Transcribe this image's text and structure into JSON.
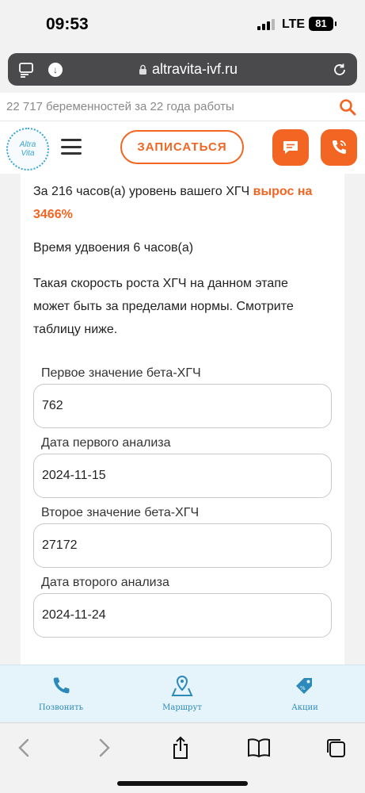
{
  "status_bar": {
    "time": "09:53",
    "network": "LTE",
    "battery": "81"
  },
  "browser": {
    "domain": "altravita-ivf.ru"
  },
  "site": {
    "tagline": "22 717 беременностей за 22 года работы",
    "logo_line1": "Altra",
    "logo_line2": "Vita",
    "signup_label": "ЗАПИСАТЬСЯ",
    "accent_color": "#f26522",
    "brand_color": "#3aa7d4"
  },
  "result": {
    "text": "За 216 часов(а) уровень вашего ХГЧ ",
    "growth": "вырос на 3466%",
    "doubling": "Время удвоения 6 часов(а)",
    "notice": "Такая скорость роста ХГЧ на данном этапе может быть за пределами нормы. Смотрите таблицу ниже."
  },
  "form": {
    "first_value_label": "Первое значение бета-ХГЧ",
    "first_value": "762",
    "first_date_label": "Дата первого анализа",
    "first_date": "2024-11-15",
    "second_value_label": "Второе значение бета-ХГЧ",
    "second_value": "27172",
    "second_date_label": "Дата второго анализа",
    "second_date": "2024-11-24"
  },
  "site_nav": {
    "call": "Позвонить",
    "route": "Маршрут",
    "promo": "Акции"
  },
  "toolbar": {
    "icons": [
      "back-icon",
      "forward-icon",
      "share-icon",
      "bookmarks-icon",
      "tabs-icon"
    ]
  }
}
